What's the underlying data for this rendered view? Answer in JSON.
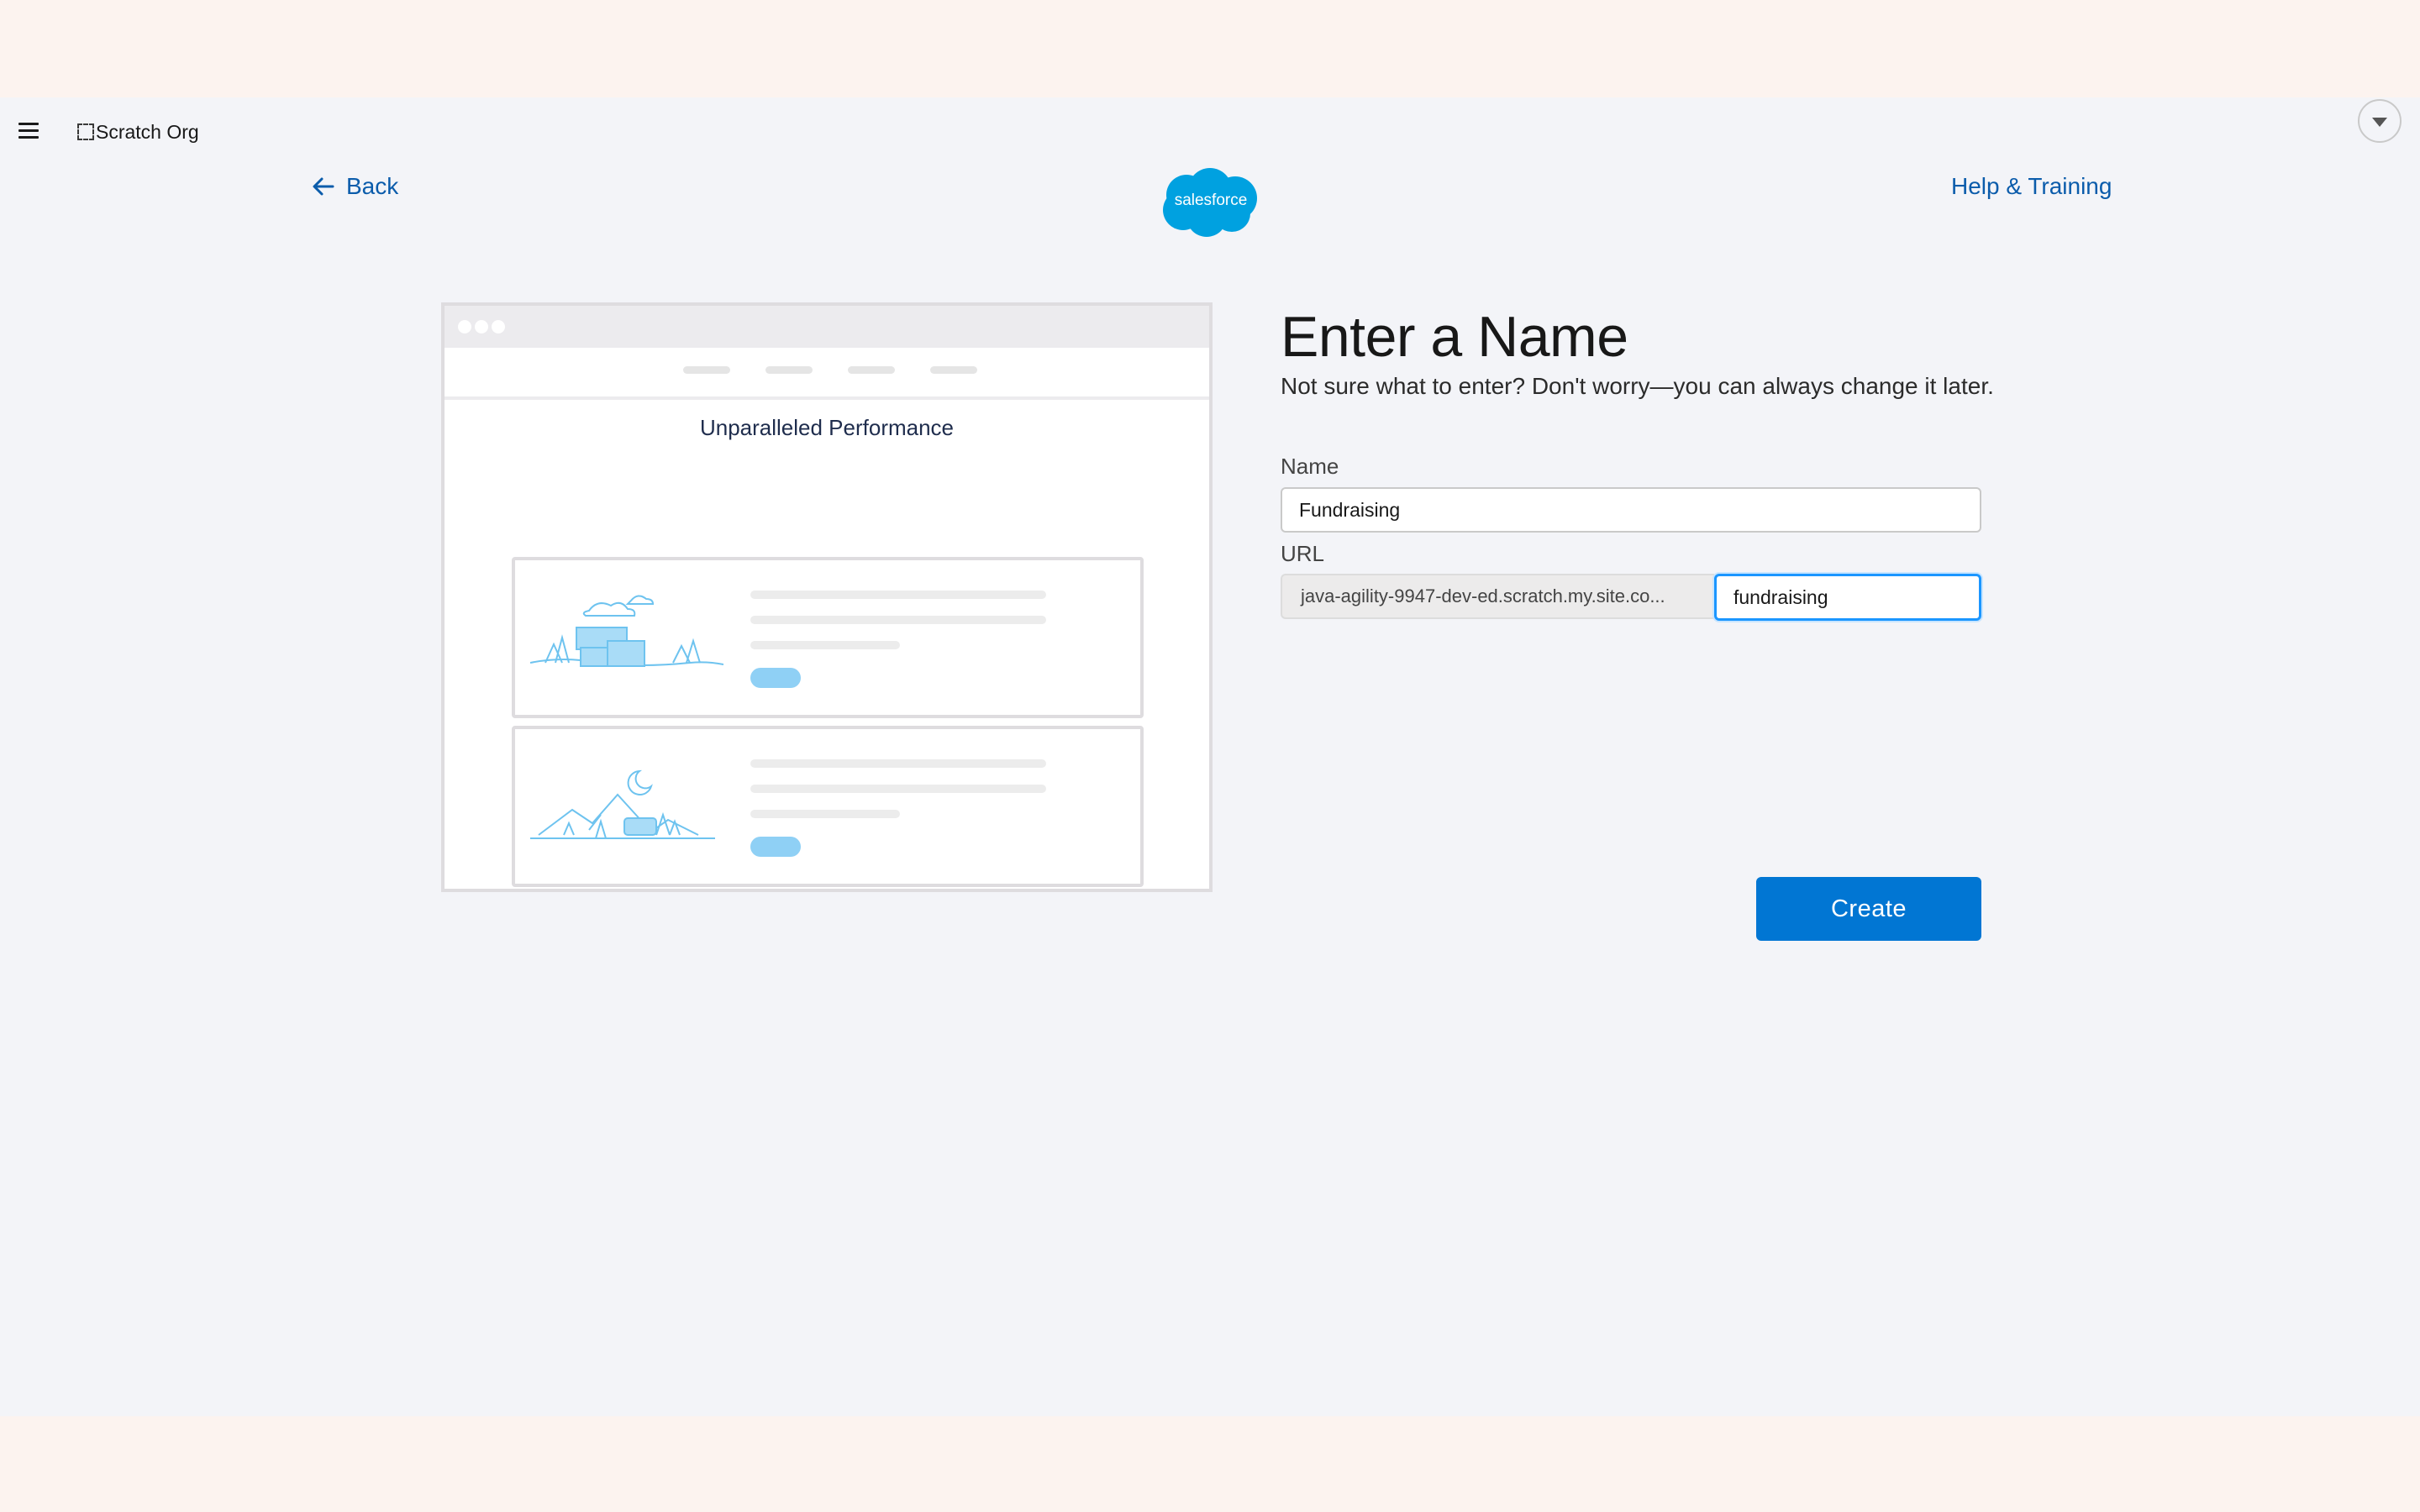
{
  "topbar": {
    "org_name": "Scratch Org",
    "icons": [
      "menu-icon",
      "dashed-box-icon",
      "chevron-down-icon"
    ]
  },
  "header": {
    "back_label": "Back",
    "logo_text": "salesforce",
    "help_label": "Help & Training"
  },
  "preview": {
    "title": "Unparalleled Performance"
  },
  "form": {
    "title": "Enter a Name",
    "subtitle": "Not sure what to enter? Don't worry—you can always change it later.",
    "name_label": "Name",
    "name_value": "Fundraising",
    "url_label": "URL",
    "url_prefix": "java-agility-9947-dev-ed.scratch.my.site.co...",
    "url_value": "fundraising",
    "create_label": "Create"
  },
  "colors": {
    "link": "#0b5cab",
    "primary_button": "#0176d3",
    "focus_border": "#1b96ff",
    "logo": "#00a1e0",
    "app_background": "#f3f4f8"
  }
}
